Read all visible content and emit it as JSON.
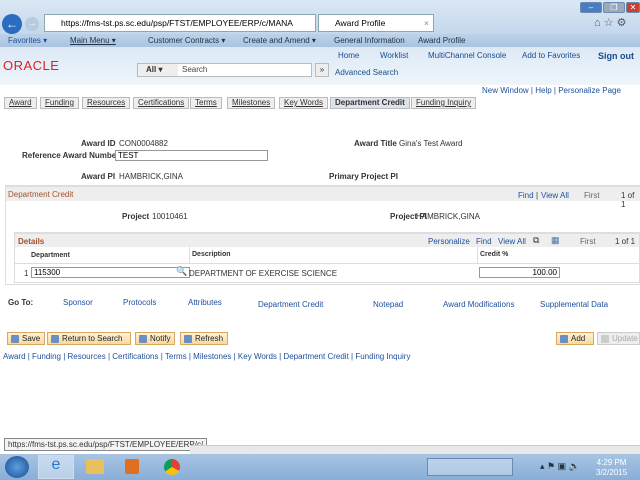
{
  "browser": {
    "url": "https://fms-tst.ps.sc.edu/psp/FTST/EMPLOYEE/ERP/c/MANA",
    "tab_title": "Award Profile",
    "status_url": "https://fms-tst.ps.sc.edu/psp/FTST/EMPLOYEE/ERP/c/"
  },
  "menu": {
    "favorites": "Favorites ▾",
    "main_menu": "Main Menu ▾",
    "crumbs": [
      "Customer Contracts ▾",
      "Create and Amend ▾",
      "General Information",
      "Award Profile"
    ]
  },
  "header": {
    "logo": "ORACLE",
    "links": [
      "Home",
      "Worklist",
      "MultiChannel Console",
      "Add to Favorites",
      "Sign out"
    ],
    "search_scope": "All",
    "search_placeholder": "Search",
    "advanced_search": "Advanced Search"
  },
  "page_links": [
    "New Window",
    "Help",
    "Personalize Page"
  ],
  "tabs": [
    "Award",
    "Funding",
    "Resources",
    "Certifications",
    "Terms",
    "Milestones",
    "Key Words",
    "Department Credit",
    "Funding Inquiry"
  ],
  "active_tab": "Department Credit",
  "form": {
    "award_id_label": "Award ID",
    "award_id": "CON0004882",
    "award_title_label": "Award Title",
    "award_title": "Gina's Test Award",
    "ref_label": "Reference Award Number",
    "ref_value": "TEST",
    "pi_label": "Award PI",
    "pi": "HAMBRICK,GINA",
    "primary_pi_label": "Primary Project PI"
  },
  "dept_credit": {
    "title": "Department Credit",
    "find": "Find",
    "view_all": "View All",
    "first": "First",
    "count": "1 of 1",
    "project_label": "Project",
    "project": "10010461",
    "project_pi_label": "Project PI",
    "project_pi": "HAMBRICK,GINA"
  },
  "details": {
    "title": "Details",
    "personalize": "Personalize",
    "find": "Find",
    "view_all": "View All",
    "first": "First",
    "count": "1 of 1",
    "columns": [
      "Department",
      "Description",
      "Credit %"
    ],
    "rows": [
      {
        "num": "1",
        "department": "115300",
        "description": "DEPARTMENT OF EXERCISE SCIENCE",
        "credit": "100.00"
      }
    ]
  },
  "goto": {
    "label": "Go To:",
    "links": [
      "Sponsor",
      "Protocols",
      "Attributes",
      "Department Credit",
      "Notepad",
      "Award Modifications",
      "Supplemental Data"
    ]
  },
  "buttons": {
    "save": "Save",
    "return": "Return to Search",
    "notify": "Notify",
    "refresh": "Refresh",
    "add": "Add",
    "update": "Update"
  },
  "bottom_links": "Award | Funding | Resources | Certifications | Terms | Milestones | Key Words | Department Credit | Funding Inquiry",
  "clock": {
    "time": "4:29 PM",
    "date": "3/2/2015"
  }
}
